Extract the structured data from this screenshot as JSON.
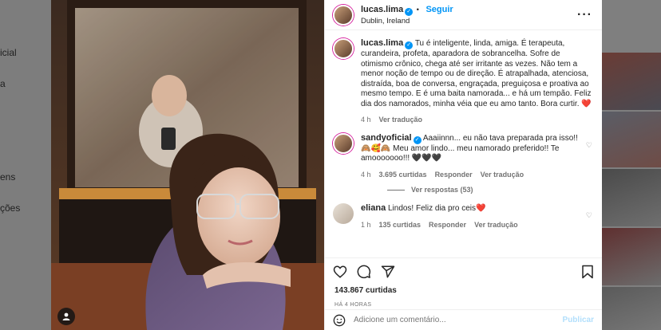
{
  "background": {
    "nav_fragments": [
      "icial",
      "a",
      "ens",
      "ções"
    ]
  },
  "post": {
    "author": "lucas.lima",
    "follow_label": "Seguir",
    "location": "Dublin, Ireland",
    "more_icon": "more-horizontal-icon",
    "caption": {
      "username": "lucas.lima",
      "text": "Tu é inteligente, linda, amiga. É terapeuta, curandeira, profeta, aparadora de sobrancelha. Sofre de otimismo crônico, chega até ser irritante as vezes. Não tem a menor noção de tempo ou de direção. É atrapalhada, atenciosa, distraída, boa de conversa, engraçada, preguiçosa e proativa ao mesmo tempo. E é uma baita namorada... e há um tempão. Feliz dia dos namorados, minha véia que eu amo tanto. Bora curtir. ❤️",
      "age": "4 h",
      "translate": "Ver tradução"
    },
    "comments": [
      {
        "username": "sandyoficial",
        "text": "Aaaiinnn... eu não tava preparada pra isso!! 🙈🥰🙈 Meu amor lindo... meu namorado preferido!! Te amooooooo!!! 🖤🖤🖤",
        "age": "4 h",
        "likes": "3.695 curtidas",
        "reply": "Responder",
        "translate": "Ver tradução",
        "view_replies": "Ver respostas (53)"
      },
      {
        "username": "eliana",
        "text": "Lindos! Feliz dia pro ceis❤️",
        "age": "1 h",
        "likes": "135 curtidas",
        "reply": "Responder",
        "translate": "Ver tradução"
      }
    ],
    "likes_total": "143.867 curtidas",
    "posted_ago": "HÁ 4 HORAS",
    "composer_placeholder": "Adicione um comentário...",
    "post_label": "Publicar"
  }
}
